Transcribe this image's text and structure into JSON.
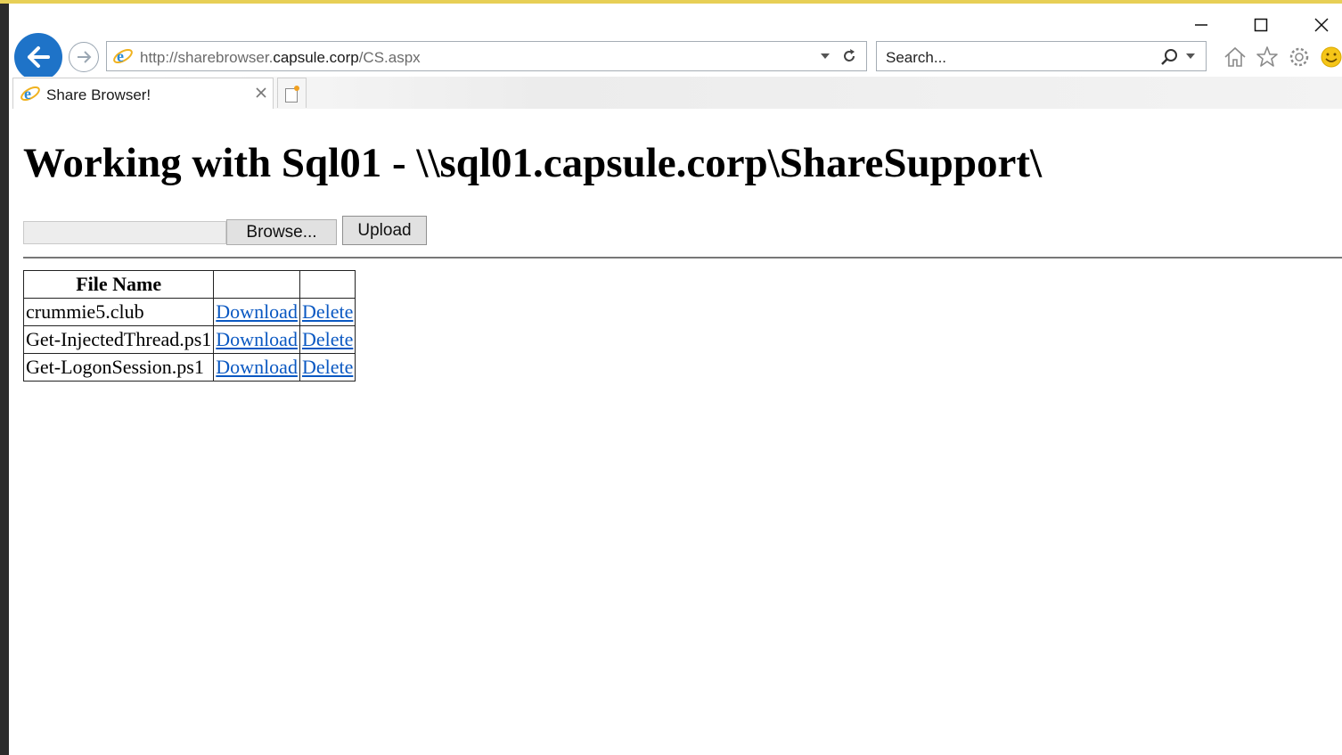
{
  "browser": {
    "address": {
      "prefix": "http://sharebrowser.",
      "domain": "capsule.corp",
      "path": "/CS.aspx"
    },
    "search_placeholder": "Search...",
    "tab_title": "Share Browser!",
    "accent_color": "#1e73c8"
  },
  "page": {
    "title": "Working with Sql01 - \\\\sql01.capsule.corp\\ShareSupport\\",
    "browse_label": "Browse...",
    "upload_label": "Upload",
    "table": {
      "headers": [
        "File Name",
        "",
        ""
      ],
      "rows": [
        {
          "name": "crummie5.club",
          "download": "Download",
          "delete": "Delete"
        },
        {
          "name": "Get-InjectedThread.ps1",
          "download": "Download",
          "delete": "Delete"
        },
        {
          "name": "Get-LogonSession.ps1",
          "download": "Download",
          "delete": "Delete"
        }
      ]
    }
  }
}
